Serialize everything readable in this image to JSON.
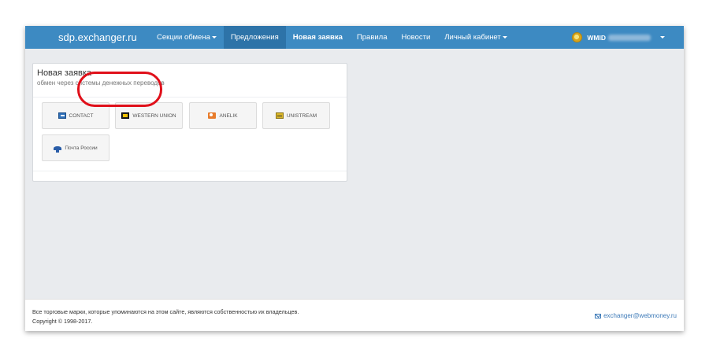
{
  "header": {
    "brand": "sdp.exchanger.ru",
    "nav": [
      {
        "label": "Секции обмена",
        "dropdown": true
      },
      {
        "label": "Предложения",
        "active": true
      },
      {
        "label": "Новая заявка",
        "bold": true
      },
      {
        "label": "Правила"
      },
      {
        "label": "Новости"
      },
      {
        "label": "Личный кабинет",
        "dropdown": true
      }
    ],
    "user": {
      "label": "WMID"
    }
  },
  "panel": {
    "title": "Новая заявка",
    "subtitle": "обмен через системы денежных переводов",
    "systems": [
      {
        "label": "CONTACT",
        "icon": "contact-logo-icon"
      },
      {
        "label": "WESTERN UNION",
        "icon": "western-union-logo-icon",
        "highlighted": true
      },
      {
        "label": "ANELIK",
        "icon": "anelik-logo-icon"
      },
      {
        "label": "UNISTREAM",
        "icon": "unistream-logo-icon"
      },
      {
        "label": "Почта России",
        "icon": "russian-post-logo-icon"
      }
    ]
  },
  "footer": {
    "disclaimer": "Все торговые марки, которые упоминаются на этом сайте, являются собственностью их владельцев.",
    "copyright": "Copyright © 1998-2017.",
    "email": "exchanger@webmoney.ru"
  },
  "colors": {
    "navbar": "#3d8ac2",
    "navbar_active": "#2d73a8",
    "highlight": "#e0101a",
    "link": "#3d7ab8"
  }
}
